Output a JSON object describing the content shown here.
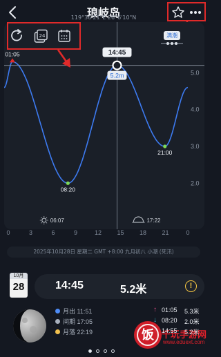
{
  "header": {
    "title": "琅岐岛",
    "coordinates": "119°36'21\"E  26°6'10\"N"
  },
  "chart_data": {
    "type": "line",
    "x_ticks": [
      "0",
      "3",
      "6",
      "9",
      "12",
      "15",
      "18",
      "21",
      "0"
    ],
    "xlim": [
      0,
      24
    ],
    "y_ticks": [
      "5.0",
      "4.0",
      "3.0",
      "2.0"
    ],
    "ylim": [
      0.9,
      6.0
    ],
    "series": [
      {
        "values": [
          {
            "x": 0,
            "y": 4.6
          },
          {
            "x": 1.08,
            "y": 5.3
          },
          {
            "x": 8.33,
            "y": 2.0
          },
          {
            "x": 14.75,
            "y": 5.2
          },
          {
            "x": 21.0,
            "y": 3.0
          },
          {
            "x": 24,
            "y": 4.6
          }
        ]
      }
    ],
    "extreme_labels": [
      {
        "x": 1.08,
        "y": 5.3,
        "text": "01:05",
        "kind": "high"
      },
      {
        "x": 8.33,
        "y": 2.0,
        "text": "08:20",
        "kind": "low"
      },
      {
        "x": 21.0,
        "y": 3.0,
        "text": "21:00",
        "kind": "low"
      }
    ],
    "cursor": {
      "x": 14.75,
      "time_label": "14:45",
      "height_label": "5.2m"
    },
    "sunrise": "06:07",
    "sunset": "17:22",
    "legend_badge": "满潮"
  },
  "info_line": "2025年10月28日 星期二 GMT +8:00 九月初八 小潮 (死汛)",
  "date_card": {
    "month": "10月",
    "day": "28"
  },
  "current": {
    "time": "14:45",
    "height": "5.2米"
  },
  "moon": {
    "rise": "月出 11:51",
    "mid": "间期 17:05",
    "set": "月落 22:19",
    "colors": {
      "rise": "#4e8cf7",
      "mid": "#a8b0bd",
      "set": "#f2c14e"
    }
  },
  "extremes": [
    {
      "time": "01:05",
      "height": "5.3米",
      "direction": "up"
    },
    {
      "time": "08:20",
      "height": "2.0米",
      "direction": "down"
    },
    {
      "time": "14:55",
      "height": "5.2米",
      "direction": "up"
    }
  ],
  "pager": {
    "count": 4,
    "active": 0
  },
  "watermark": {
    "text": "千玩手游网",
    "url": "www.eduext.com"
  },
  "colors": {
    "accent": "#e02a2a",
    "curve": "#3d7bf2",
    "low_point": "#7ed957",
    "high_point": "#e02a2a"
  }
}
